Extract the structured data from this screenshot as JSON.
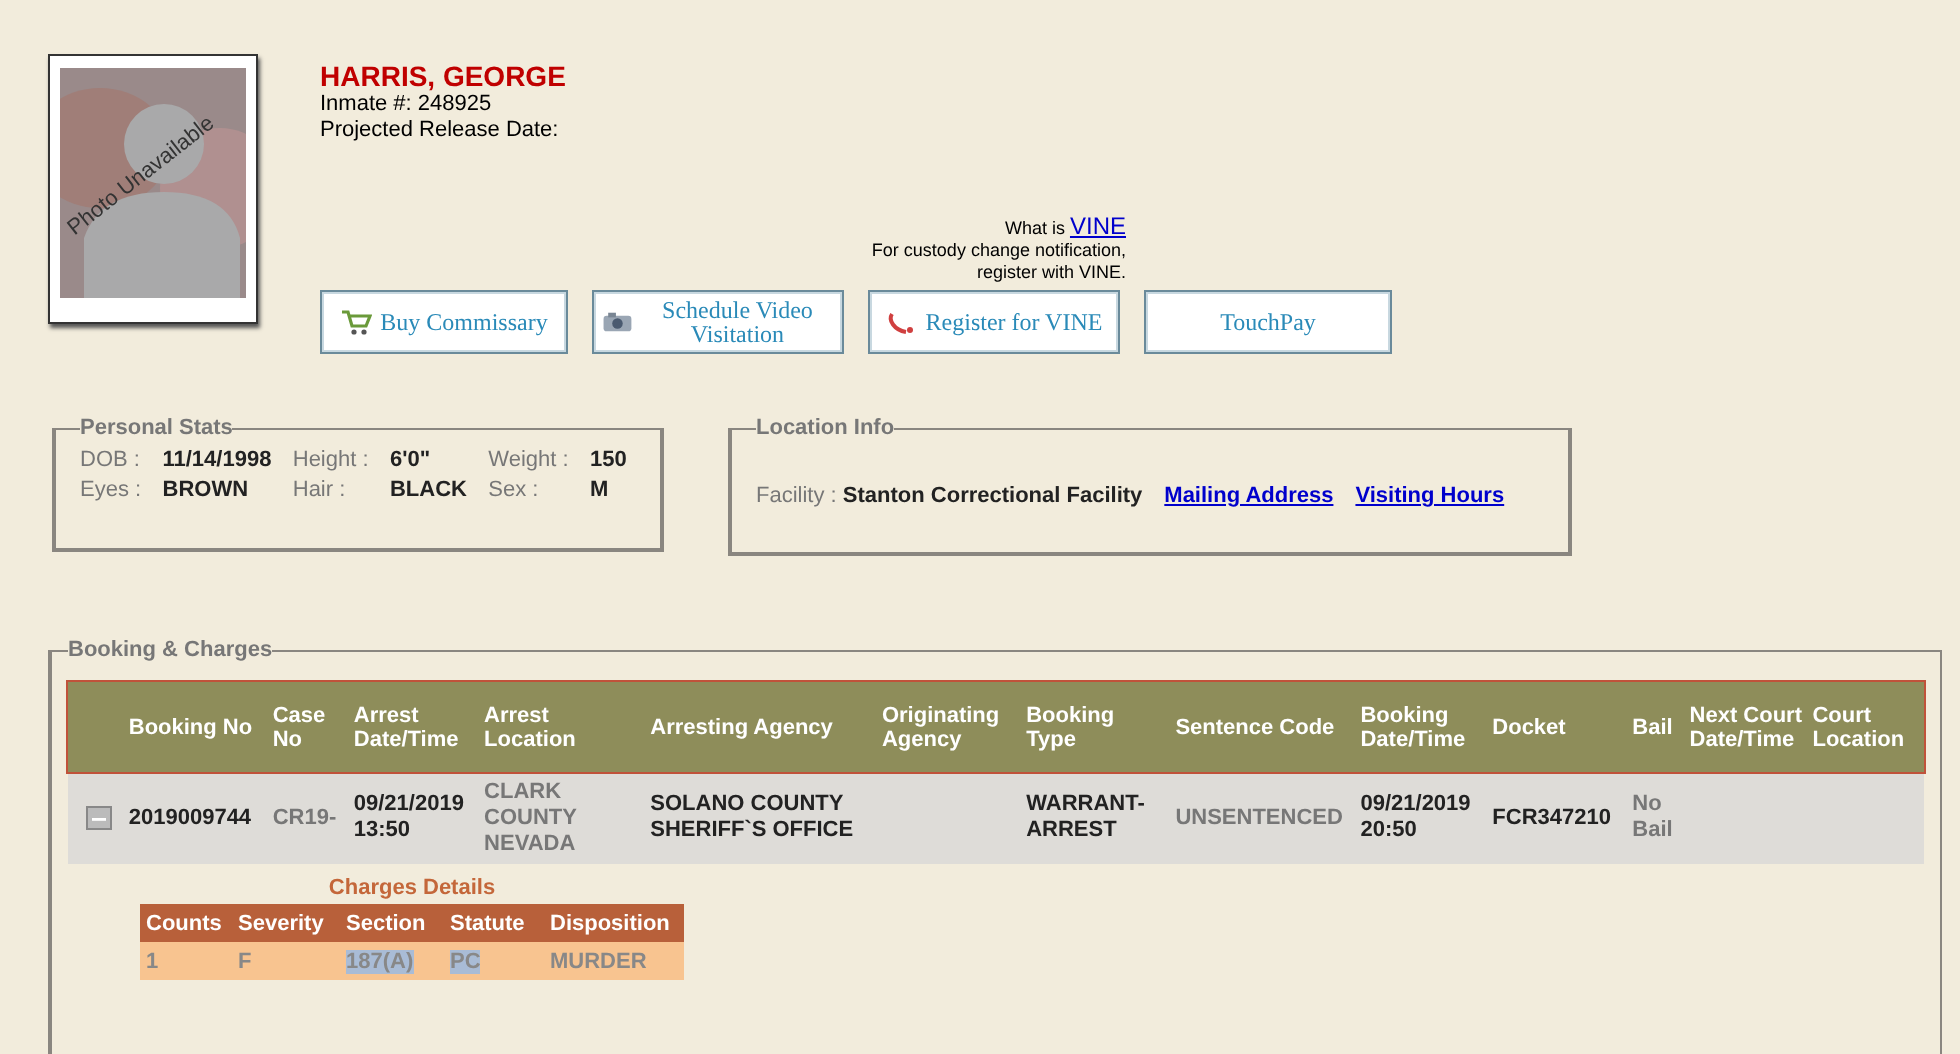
{
  "inmate": {
    "name": "HARRIS, GEORGE",
    "inmate_number": "Inmate #: 248925",
    "release_label": "Projected Release Date:",
    "photo_text": "Photo Unavailable"
  },
  "vine": {
    "prefix": "What is ",
    "link": "VINE",
    "note_1": "For custody change notification,",
    "note_2": "register with VINE."
  },
  "actions": [
    {
      "kind": "cart",
      "label": "Buy Commissary"
    },
    {
      "kind": "camera",
      "label": "Schedule Video Visitation"
    },
    {
      "kind": "phone",
      "label": "Register for VINE"
    },
    {
      "kind": "none",
      "label": "TouchPay"
    }
  ],
  "personal_stats": {
    "title": "Personal Stats",
    "fields": [
      {
        "label": "DOB :",
        "value": "11/14/1998"
      },
      {
        "label": "Height :",
        "value": "6'0\""
      },
      {
        "label": "Weight :",
        "value": "150"
      },
      {
        "label": "Eyes :",
        "value": "BROWN"
      },
      {
        "label": "Hair :",
        "value": "BLACK"
      },
      {
        "label": "Sex :",
        "value": "M"
      }
    ]
  },
  "location_info": {
    "title": "Location Info",
    "facility_label": "Facility :",
    "facility": "Stanton Correctional Facility",
    "links": [
      "Mailing Address",
      "Visiting Hours"
    ]
  },
  "booking": {
    "title": "Booking & Charges",
    "columns": [
      "Booking No",
      "Case No",
      "Arrest Date/Time",
      "Arrest Location",
      "Arresting Agency",
      "Originating Agency",
      "Booking Type",
      "Sentence Code",
      "Booking Date/Time",
      "Docket",
      "Bail",
      "Next Court Date/Time",
      "Court Location"
    ],
    "rows": [
      {
        "expanded": true,
        "cells": [
          "2019009744",
          "CR19-",
          "09/21/2019 13:50",
          "CLARK COUNTY NEVADA",
          "SOLANO COUNTY SHERIFF`S OFFICE",
          "",
          "WARRANT-ARREST",
          "UNSENTENCED",
          "09/21/2019 20:50",
          "FCR347210",
          "No Bail",
          "",
          ""
        ]
      }
    ],
    "charges": {
      "title": "Charges Details",
      "columns": [
        "Counts",
        "Severity",
        "Section",
        "Statute",
        "Disposition"
      ],
      "rows": [
        {
          "cells": [
            {
              "text": "1",
              "highlighted": false
            },
            {
              "text": "F",
              "highlighted": false
            },
            {
              "text": "187(A)",
              "highlighted": true
            },
            {
              "text": "PC",
              "highlighted": true
            },
            {
              "text": "MURDER",
              "highlighted": false
            }
          ]
        }
      ]
    }
  }
}
